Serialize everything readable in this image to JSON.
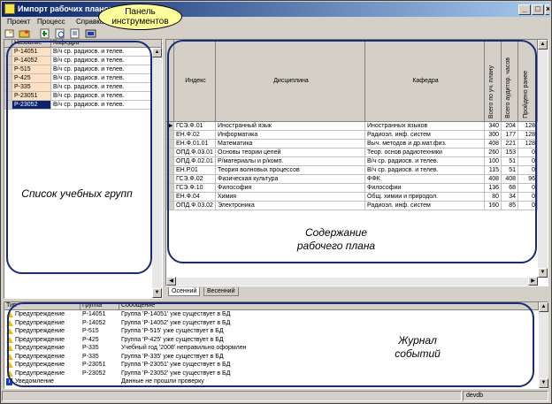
{
  "window": {
    "title": "Импорт рабочих планов"
  },
  "menu": [
    "Проект",
    "Процесс",
    "Справка"
  ],
  "callouts": {
    "toolbar": "Панель инструментов",
    "groups": "Список учебных групп",
    "plan": "Содержание рабочего плана",
    "journal": "Журнал событий"
  },
  "groups": {
    "columns": [
      "Название",
      "Кафедра"
    ],
    "rows": [
      {
        "name": "Р-14051",
        "dept": "В/ч ср. радиосв. и телев."
      },
      {
        "name": "Р-14052",
        "dept": "В/ч ср. радиосв. и телев."
      },
      {
        "name": "Р-515",
        "dept": "В/ч ср. радиосв. и телев."
      },
      {
        "name": "Р-425",
        "dept": "В/ч ср. радиосв. и телев."
      },
      {
        "name": "Р-335",
        "dept": "В/ч ср. радиосв. и телев."
      },
      {
        "name": "Р-23051",
        "dept": "В/ч ср. радиосв. и телев."
      },
      {
        "name": "Р-23052",
        "dept": "В/ч ср. радиосв. и телев."
      }
    ]
  },
  "plan": {
    "columns": [
      "Индекс",
      "Дисциплина",
      "Кафедра",
      "Всего по уч. плану",
      "Всего аудитор. часов",
      "Пройдено ранее"
    ],
    "rows": [
      {
        "idx": "ГСЭ.Ф.01",
        "disc": "Иностранный язык",
        "dept": "Иностранных языков",
        "a": "340",
        "b": "204",
        "c": "128"
      },
      {
        "idx": "ЕН.Ф.02",
        "disc": "Информатика",
        "dept": "Радиоэл. инф. систем",
        "a": "300",
        "b": "177",
        "c": "128"
      },
      {
        "idx": "ЕН.Ф.01.01",
        "disc": "Математика",
        "dept": "Выч. методов и др.мат.физ.",
        "a": "408",
        "b": "221",
        "c": "128"
      },
      {
        "idx": "ОПД.Ф.03.01",
        "disc": "Основы теории цепей",
        "dept": "Теор. основ радиотехники",
        "a": "260",
        "b": "153",
        "c": "0"
      },
      {
        "idx": "ОПД.Ф.02.01",
        "disc": "Р/материалы и р/комп.",
        "dept": "В/ч ср. радиосв. и телев.",
        "a": "100",
        "b": "51",
        "c": "0"
      },
      {
        "idx": "ЕН.Р.01",
        "disc": "Теория волновых процессов",
        "dept": "В/ч ср. радиосв. и телев.",
        "a": "115",
        "b": "51",
        "c": "0"
      },
      {
        "idx": "ГСЭ.Ф.02",
        "disc": "Физическая культура",
        "dept": "ФФК",
        "a": "408",
        "b": "408",
        "c": "96"
      },
      {
        "idx": "ГСЭ.Ф.10",
        "disc": "Философия",
        "dept": "Философии",
        "a": "136",
        "b": "68",
        "c": "0"
      },
      {
        "idx": "ЕН.Ф.04",
        "disc": "Химия",
        "dept": "Общ. химии и природол.",
        "a": "80",
        "b": "34",
        "c": "0"
      },
      {
        "idx": "ОПД.Ф.03.02",
        "disc": "Электроника",
        "dept": "Радиоэл. инф. систем",
        "a": "160",
        "b": "85",
        "c": "0"
      }
    ],
    "tabs": [
      "Осенний",
      "Весенний"
    ]
  },
  "journal": {
    "columns": [
      "Тип",
      "Группа",
      "Сообщение"
    ],
    "rows": [
      {
        "type": "Предупреждение",
        "group": "Р-14051",
        "msg": "Группа 'Р-14051' уже существует в БД",
        "icon": "warning-icon"
      },
      {
        "type": "Предупреждение",
        "group": "Р-14052",
        "msg": "Группа 'Р-14052' уже существует в БД",
        "icon": "warning-icon"
      },
      {
        "type": "Предупреждение",
        "group": "Р-515",
        "msg": "Группа 'Р-515' уже существует в БД",
        "icon": "warning-icon"
      },
      {
        "type": "Предупреждение",
        "group": "Р-425",
        "msg": "Группа 'Р-425' уже существует в БД",
        "icon": "warning-icon"
      },
      {
        "type": "Предупреждение",
        "group": "Р-335",
        "msg": "Учебный год '2008' неправильно оформлен",
        "icon": "warning-icon"
      },
      {
        "type": "Предупреждение",
        "group": "Р-335",
        "msg": "Группа 'Р-335' уже существует в БД",
        "icon": "warning-icon"
      },
      {
        "type": "Предупреждение",
        "group": "Р-23051",
        "msg": "Группа 'Р-23051' уже существует в БД",
        "icon": "warning-icon"
      },
      {
        "type": "Предупреждение",
        "group": "Р-23052",
        "msg": "Группа 'Р-23052' уже существует в БД",
        "icon": "warning-icon"
      },
      {
        "type": "Уведомление",
        "group": "",
        "msg": "Данные не прошли проверку",
        "icon": "info-icon"
      }
    ]
  },
  "status": {
    "db": "devdb"
  }
}
